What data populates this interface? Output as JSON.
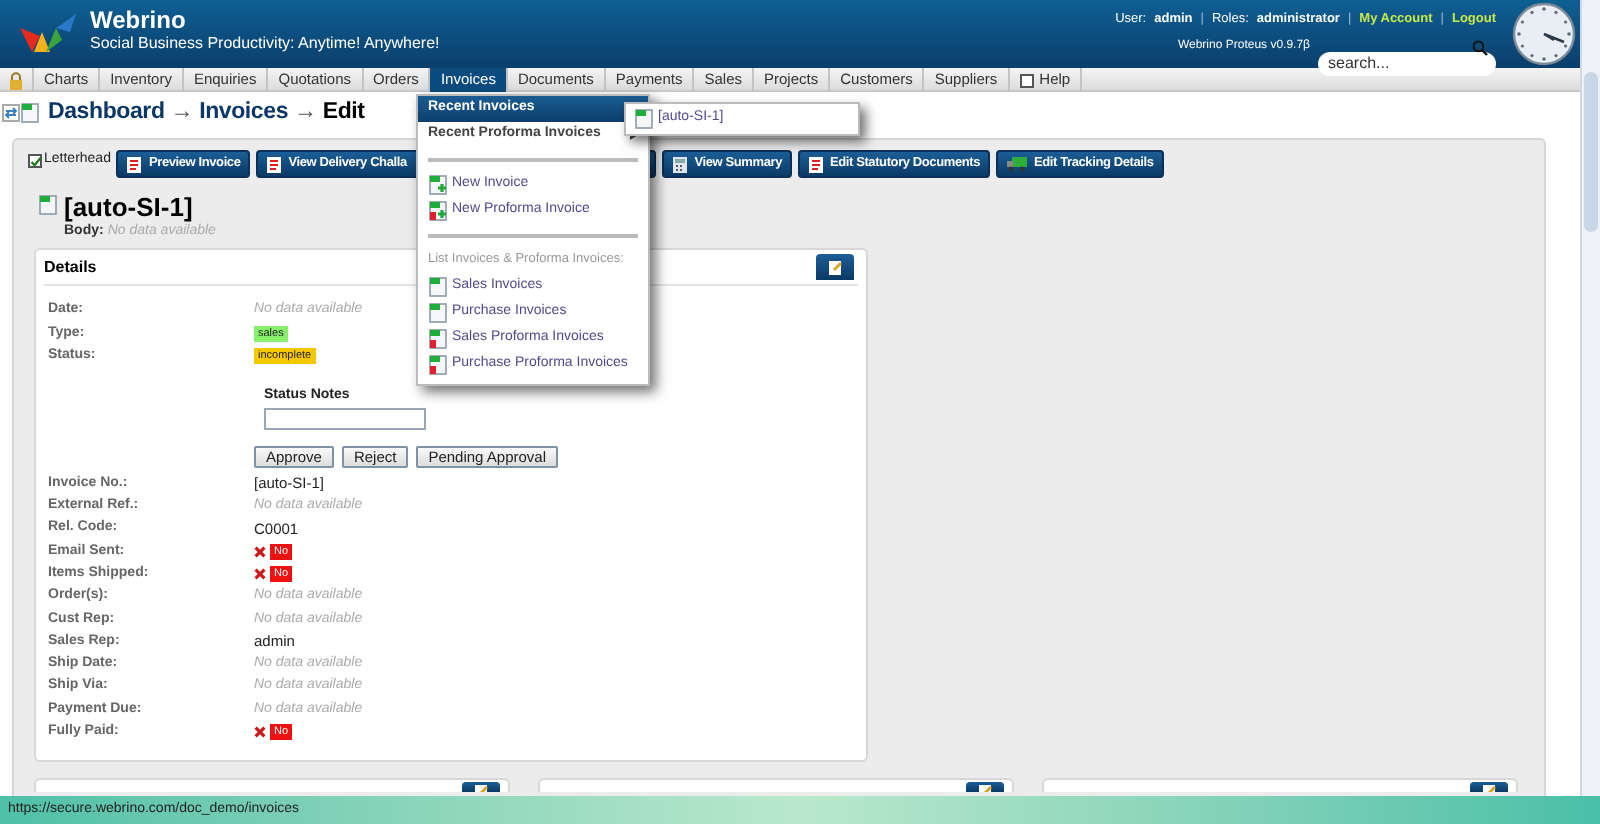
{
  "header": {
    "app_name": "Webrino",
    "tagline": "Social Business Productivity: Anytime! Anywhere!",
    "user_line": [
      {
        "kind": "label",
        "text": "User:"
      },
      {
        "kind": "value",
        "text": "admin"
      },
      {
        "kind": "sep",
        "text": "|"
      },
      {
        "kind": "label",
        "text": "Roles:"
      },
      {
        "kind": "value",
        "text": "administrator"
      },
      {
        "kind": "sep",
        "text": "|"
      },
      {
        "kind": "link",
        "text": "My Account"
      },
      {
        "kind": "sep",
        "text": "|"
      },
      {
        "kind": "link",
        "text": "Logout"
      }
    ],
    "version": "Webrino Proteus v0.9.7β",
    "search": {
      "placeholder": "search..."
    }
  },
  "nav": [
    {
      "kind": "lock",
      "selected": false
    },
    {
      "kind": "text",
      "label": "Charts",
      "selected": false
    },
    {
      "kind": "text",
      "label": "Inventory",
      "selected": false
    },
    {
      "kind": "text",
      "label": "Enquiries",
      "selected": false
    },
    {
      "kind": "text",
      "label": "Quotations",
      "selected": false
    },
    {
      "kind": "text",
      "label": "Orders",
      "selected": false
    },
    {
      "kind": "text",
      "label": "Invoices",
      "selected": true
    },
    {
      "kind": "text",
      "label": "Documents",
      "selected": false
    },
    {
      "kind": "text",
      "label": "Payments",
      "selected": false
    },
    {
      "kind": "text",
      "label": "Sales",
      "selected": false
    },
    {
      "kind": "text",
      "label": "Projects",
      "selected": false
    },
    {
      "kind": "text",
      "label": "Customers",
      "selected": false
    },
    {
      "kind": "text",
      "label": "Suppliers",
      "selected": false
    },
    {
      "kind": "help",
      "label": "Help",
      "selected": false
    }
  ],
  "breadcrumb": [
    {
      "kind": "link",
      "label": "Dashboard"
    },
    {
      "kind": "sep",
      "label": "→"
    },
    {
      "kind": "link",
      "label": "Invoices"
    },
    {
      "kind": "sep",
      "label": "→"
    },
    {
      "kind": "current",
      "label": "Edit"
    }
  ],
  "letterhead": {
    "label": "Letterhead",
    "checked": true
  },
  "actions": [
    {
      "kind": "pdf",
      "label": "Preview Invoice"
    },
    {
      "kind": "pdf",
      "label": "View Delivery Challa"
    },
    {
      "kind": "calc",
      "label": "View Summary"
    },
    {
      "kind": "pdf",
      "label": "Edit Statutory Documents"
    },
    {
      "kind": "truck",
      "label": "Edit Tracking Details"
    }
  ],
  "record": {
    "title": "[auto-SI-1]",
    "body_label": "Body:",
    "body": "No data available"
  },
  "details": {
    "title": "Details",
    "fields_top": [
      {
        "label": "Date:",
        "kind": "empty",
        "value": "No data available"
      },
      {
        "label": "Type:",
        "kind": "tag",
        "value": "sales",
        "color": "#86f06a"
      },
      {
        "label": "Status:",
        "kind": "tag",
        "value": "incomplete",
        "color": "#f7c800"
      }
    ],
    "status_notes": {
      "label": "Status Notes"
    },
    "approval_buttons": [
      "Approve",
      "Reject",
      "Pending Approval"
    ],
    "fields": [
      {
        "label": "Invoice No.:",
        "kind": "text",
        "value": "[auto-SI-1]"
      },
      {
        "label": "External Ref.:",
        "kind": "empty",
        "value": "No data available"
      },
      {
        "label": "Rel. Code:",
        "kind": "text",
        "value": "C0001"
      },
      {
        "label": "Email Sent:",
        "kind": "no",
        "value": "No"
      },
      {
        "label": "Items Shipped:",
        "kind": "no",
        "value": "No"
      },
      {
        "label": "Order(s):",
        "kind": "empty",
        "value": "No data available"
      },
      {
        "label": "Cust Rep:",
        "kind": "empty",
        "value": "No data available"
      },
      {
        "label": "Sales Rep:",
        "kind": "text",
        "value": "admin"
      },
      {
        "label": "Ship Date:",
        "kind": "empty",
        "value": "No data available"
      },
      {
        "label": "Ship Via:",
        "kind": "empty",
        "value": "No data available"
      },
      {
        "label": "Payment Due:",
        "kind": "empty",
        "value": "No data available"
      },
      {
        "label": "Fully Paid:",
        "kind": "no",
        "value": "No"
      }
    ]
  },
  "menu": {
    "items": [
      {
        "kind": "header",
        "label": "Recent Invoices",
        "selected": true
      },
      {
        "kind": "submenu",
        "label": "Recent Proforma Invoices",
        "selected": false
      },
      {
        "kind": "separator"
      },
      {
        "kind": "new",
        "label": "New Invoice",
        "selected": false
      },
      {
        "kind": "new_proforma",
        "label": "New Proforma Invoice",
        "selected": false
      },
      {
        "kind": "separator"
      },
      {
        "kind": "caption",
        "label": "List Invoices & Proforma Invoices:"
      },
      {
        "kind": "list",
        "label": "Sales Invoices",
        "selected": false
      },
      {
        "kind": "list",
        "label": "Purchase Invoices",
        "selected": false
      },
      {
        "kind": "list_proforma",
        "label": "Sales Proforma Invoices",
        "selected": false
      },
      {
        "kind": "list_proforma",
        "label": "Purchase Proforma Invoices",
        "selected": false
      }
    ],
    "submenu": [
      "[auto-SI-1]"
    ]
  },
  "status_bar": {
    "url": "https://secure.webrino.com/doc_demo/invoices"
  }
}
